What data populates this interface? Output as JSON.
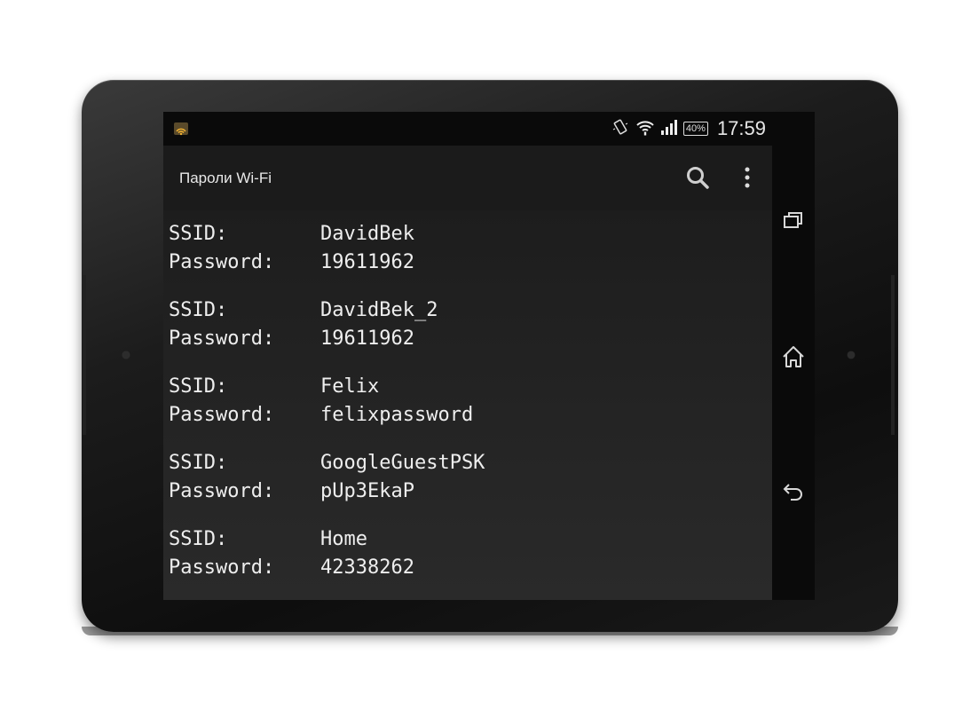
{
  "app": {
    "title": "Пароли Wi-Fi"
  },
  "status_bar": {
    "time": "17:59",
    "battery": "40%",
    "icons": [
      "wifi-notify-icon",
      "vibrate-icon",
      "wifi-icon",
      "signal-icon",
      "battery-icon"
    ]
  },
  "action_bar": {
    "icons": [
      "search-icon",
      "overflow-menu-icon"
    ]
  },
  "labels": {
    "ssid": "SSID:",
    "password": "Password:"
  },
  "networks": [
    {
      "ssid": "DavidBek",
      "password": "19611962"
    },
    {
      "ssid": "DavidBek_2",
      "password": "19611962"
    },
    {
      "ssid": "Felix",
      "password": "felixpassword"
    },
    {
      "ssid": "GoogleGuestPSK",
      "password": "pUp3EkaP"
    },
    {
      "ssid": "Home",
      "password": "42338262"
    }
  ],
  "nav_bar": {
    "icons": [
      "recent-apps-icon",
      "home-icon",
      "back-icon"
    ]
  },
  "colors": {
    "background": "#2a2a2a",
    "action_bar": "#1b1b1b",
    "text": "#eeeeee"
  }
}
